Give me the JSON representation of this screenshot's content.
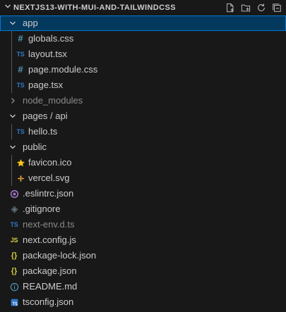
{
  "explorer": {
    "title": "NEXTJS13-WITH-MUI-AND-TAILWINDCSS",
    "actions": [
      "new-file-icon",
      "new-folder-icon",
      "refresh-icon",
      "collapse-all-icon"
    ],
    "colors": {
      "background": "#181818",
      "selection": "#04395e",
      "selection_border": "#0078d4",
      "ts_blue": "#3178c6",
      "css_blue": "#519aba",
      "json_yellow": "#cbcb41",
      "star_yellow": "#f5c518",
      "eslint_purple": "#a074c4"
    }
  },
  "tree": [
    {
      "label": "app",
      "type": "folder",
      "expanded": true,
      "depth": 0,
      "selected": true
    },
    {
      "label": "globals.css",
      "type": "file",
      "icon": "#",
      "icon_name": "css-icon",
      "depth": 1
    },
    {
      "label": "layout.tsx",
      "type": "file",
      "icon": "TS",
      "icon_name": "typescript-icon",
      "depth": 1
    },
    {
      "label": "page.module.css",
      "type": "file",
      "icon": "#",
      "icon_name": "css-icon",
      "depth": 1
    },
    {
      "label": "page.tsx",
      "type": "file",
      "icon": "TS",
      "icon_name": "typescript-icon",
      "depth": 1
    },
    {
      "label": "node_modules",
      "type": "folder",
      "expanded": false,
      "depth": 0,
      "dimmed": true
    },
    {
      "label": "pages / api",
      "type": "folder",
      "expanded": true,
      "depth": 0
    },
    {
      "label": "hello.ts",
      "type": "file",
      "icon": "TS",
      "icon_name": "typescript-icon",
      "depth": 1
    },
    {
      "label": "public",
      "type": "folder",
      "expanded": true,
      "depth": 0
    },
    {
      "label": "favicon.ico",
      "type": "file",
      "icon": "★",
      "icon_name": "star-icon",
      "depth": 1
    },
    {
      "label": "vercel.svg",
      "type": "file",
      "icon": "svg",
      "icon_name": "svg-file-icon",
      "depth": 1
    },
    {
      "label": ".eslintrc.json",
      "type": "file",
      "icon": "eslint",
      "icon_name": "eslint-icon",
      "depth": 0
    },
    {
      "label": ".gitignore",
      "type": "file",
      "icon": "git",
      "icon_name": "git-icon",
      "depth": 0
    },
    {
      "label": "next-env.d.ts",
      "type": "file",
      "icon": "TS",
      "icon_name": "typescript-icon",
      "depth": 0,
      "dimmed": true
    },
    {
      "label": "next.config.js",
      "type": "file",
      "icon": "JS",
      "icon_name": "javascript-icon",
      "depth": 0
    },
    {
      "label": "package-lock.json",
      "type": "file",
      "icon": "{}",
      "icon_name": "json-icon",
      "depth": 0
    },
    {
      "label": "package.json",
      "type": "file",
      "icon": "{}",
      "icon_name": "json-icon",
      "depth": 0
    },
    {
      "label": "README.md",
      "type": "file",
      "icon": "info",
      "icon_name": "info-icon",
      "depth": 0
    },
    {
      "label": "tsconfig.json",
      "type": "file",
      "icon": "tsconfig",
      "icon_name": "tsconfig-icon",
      "depth": 0
    }
  ]
}
